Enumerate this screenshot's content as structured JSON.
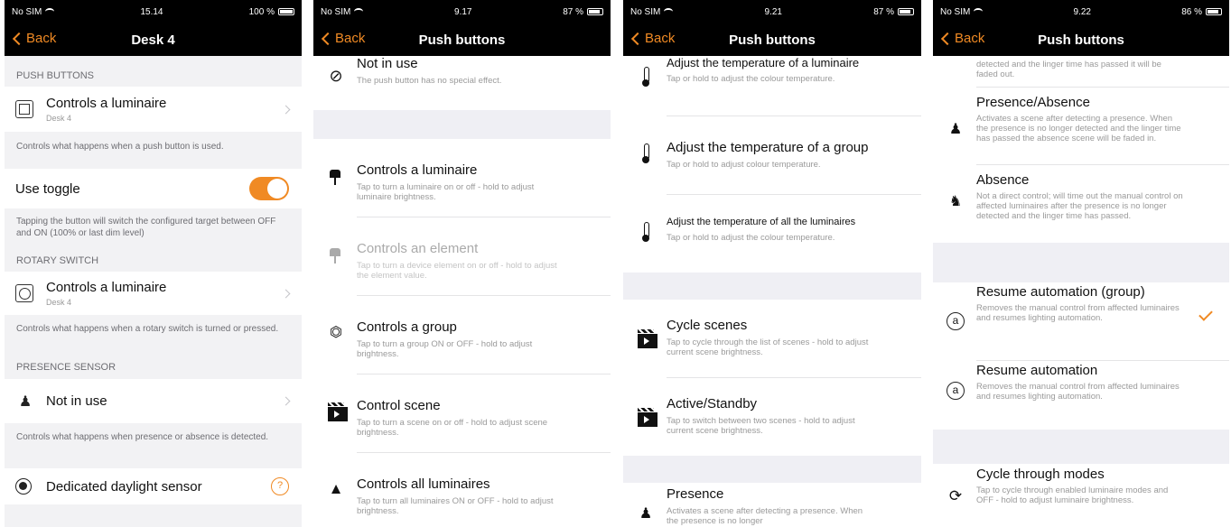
{
  "colors": {
    "accent": "#f08a24",
    "bar": "#000000",
    "group_bg": "#f2f2f4"
  },
  "screen1": {
    "status": {
      "carrier": "No SIM",
      "time": "15.14",
      "battery": "100 %"
    },
    "nav": {
      "back": "Back",
      "title": "Desk 4"
    },
    "push_header": "PUSH BUTTONS",
    "push_cell": {
      "label": "Controls a luminaire",
      "sub": "Desk 4"
    },
    "push_footer": "Controls what happens when a push button is used.",
    "toggle": {
      "label": "Use toggle",
      "on": true
    },
    "toggle_footer": "Tapping the button will switch the configured target between OFF and ON (100% or last dim level)",
    "rotary_header": "ROTARY SWITCH",
    "rotary_cell": {
      "label": "Controls a luminaire",
      "sub": "Desk 4"
    },
    "rotary_footer": "Controls what happens when a rotary switch is turned or pressed.",
    "presence_header": "PRESENCE SENSOR",
    "presence_cell": {
      "label": "Not in use"
    },
    "presence_footer": "Controls what happens when presence or absence is detected.",
    "daylight": {
      "label": "Dedicated daylight sensor",
      "help": "?"
    }
  },
  "screen2": {
    "status": {
      "carrier": "No SIM",
      "time": "9.17",
      "battery": "87 %"
    },
    "nav": {
      "back": "Back",
      "title": "Push buttons"
    },
    "options": [
      {
        "title": "Not in use",
        "desc": "The push button has no special effect.",
        "icon": "prohibited-icon"
      },
      {
        "title": "Controls a luminaire",
        "desc": "Tap to turn a luminaire on or off - hold to adjust luminaire brightness.",
        "icon": "lamp-icon"
      },
      {
        "title": "Controls an element",
        "desc": "Tap to turn a device element on or off - hold to adjust the element value.",
        "icon": "lamp-icon"
      },
      {
        "title": "Controls a group",
        "desc": "Tap to turn a group ON or OFF - hold to adjust brightness.",
        "icon": "group-icon"
      },
      {
        "title": "Control scene",
        "desc": "Tap to turn a scene on or off - hold to adjust scene brightness.",
        "icon": "clapperboard-icon"
      },
      {
        "title": "Controls all luminaires",
        "desc": "Tap to turn all luminaires ON or OFF - hold to adjust brightness.",
        "icon": "all-luminaires-icon"
      }
    ]
  },
  "screen3": {
    "status": {
      "carrier": "No SIM",
      "time": "9.21",
      "battery": "87 %"
    },
    "nav": {
      "back": "Back",
      "title": "Push buttons"
    },
    "options": [
      {
        "title": "Adjust the temperature of a luminaire",
        "desc": "Tap or hold to adjust the colour temperature.",
        "icon": "thermometer-icon"
      },
      {
        "title": "Adjust the temperature of a group",
        "desc": "Tap or hold to adjust colour temperature.",
        "icon": "thermometer-icon"
      },
      {
        "title": "Adjust the temperature of all the luminaires",
        "desc": "Tap or hold to adjust the colour temperature.",
        "icon": "thermometer-icon"
      },
      {
        "title": "Cycle scenes",
        "desc": "Tap to cycle through the list of scenes - hold to adjust current scene brightness.",
        "icon": "clapperboard-icon"
      },
      {
        "title": "Active/Standby",
        "desc": "Tap to switch between two scenes - hold to adjust current scene brightness.",
        "icon": "clapperboard-icon"
      },
      {
        "title": "Presence",
        "desc": "Activates a scene after detecting a presence. When the presence is no longer",
        "icon": "presence-icon"
      }
    ]
  },
  "screen4": {
    "status": {
      "carrier": "No SIM",
      "time": "9.22",
      "battery": "86 %"
    },
    "nav": {
      "back": "Back",
      "title": "Push buttons"
    },
    "top_fragment": "detected and the linger time has passed it will be faded out.",
    "options": [
      {
        "title": "Presence/Absence",
        "desc": "Activates a scene after detecting a presence. When the presence is no longer detected and the linger time has passed the absence scene will be faded in.",
        "icon": "presence-icon"
      },
      {
        "title": "Absence",
        "desc": "Not a direct control; will time out the manual control on affected luminaires after the presence is no longer detected and the linger time has passed.",
        "icon": "absence-icon"
      },
      {
        "title": "Resume automation (group)",
        "desc": "Removes the manual control from affected luminaires and resumes lighting automation.",
        "icon": "automation-icon",
        "checked": true
      },
      {
        "title": "Resume automation",
        "desc": "Removes the manual control from affected luminaires and resumes lighting automation.",
        "icon": "automation-icon"
      },
      {
        "title": "Cycle through modes",
        "desc": "Tap to cycle through enabled luminaire modes and OFF - hold to adjust luminaire brightness.",
        "icon": "cycle-icon"
      }
    ],
    "automation_glyph": "a"
  }
}
